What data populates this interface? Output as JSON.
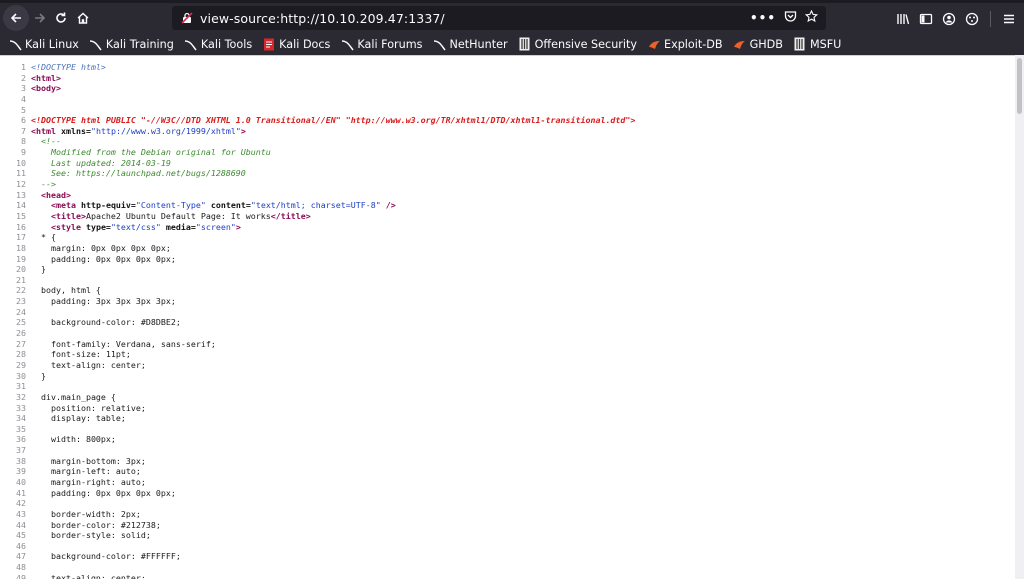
{
  "browser": {
    "url": "view-source:http://10.10.209.47:1337/"
  },
  "bookmarks": [
    {
      "label": "Kali Linux",
      "icon": "kali-dragon-icon"
    },
    {
      "label": "Kali Training",
      "icon": "kali-dragon-icon"
    },
    {
      "label": "Kali Tools",
      "icon": "kali-dragon-icon"
    },
    {
      "label": "Kali Docs",
      "icon": "kali-docs-icon"
    },
    {
      "label": "Kali Forums",
      "icon": "kali-dragon-icon"
    },
    {
      "label": "NetHunter",
      "icon": "kali-dragon-icon"
    },
    {
      "label": "Offensive Security",
      "icon": "offsec-icon"
    },
    {
      "label": "Exploit-DB",
      "icon": "exploitdb-icon"
    },
    {
      "label": "GHDB",
      "icon": "exploitdb-icon"
    },
    {
      "label": "MSFU",
      "icon": "offsec-icon"
    }
  ],
  "source_lines": [
    [
      [
        "doc",
        "<!DOCTYPE html>"
      ]
    ],
    [
      [
        "tag",
        "<html>"
      ]
    ],
    [
      [
        "tag",
        "<body>"
      ]
    ],
    [],
    [],
    [
      [
        "red",
        "<!DOCTYPE html PUBLIC \"-//W3C//DTD XHTML 1.0 Transitional//EN\" \"http://www.w3.org/TR/xhtml1/DTD/xhtml1-transitional.dtd\">"
      ]
    ],
    [
      [
        "tag",
        "<html "
      ],
      [
        "att",
        "xmlns="
      ],
      [
        "val",
        "\"http://www.w3.org/1999/xhtml\""
      ],
      [
        "tag",
        ">"
      ]
    ],
    [
      [
        "txt",
        "  "
      ],
      [
        "com",
        "<!--"
      ]
    ],
    [
      [
        "com",
        "    Modified from the Debian original for Ubuntu"
      ]
    ],
    [
      [
        "com",
        "    Last updated: 2014-03-19"
      ]
    ],
    [
      [
        "com",
        "    See: https://launchpad.net/bugs/1288690"
      ]
    ],
    [
      [
        "com",
        "  -->"
      ]
    ],
    [
      [
        "txt",
        "  "
      ],
      [
        "tag",
        "<head>"
      ]
    ],
    [
      [
        "txt",
        "    "
      ],
      [
        "tag",
        "<meta "
      ],
      [
        "att",
        "http-equiv="
      ],
      [
        "val",
        "\"Content-Type\""
      ],
      [
        "att",
        " content="
      ],
      [
        "val",
        "\"text/html; charset=UTF-8\""
      ],
      [
        "tag",
        " />"
      ]
    ],
    [
      [
        "txt",
        "    "
      ],
      [
        "tag",
        "<title>"
      ],
      [
        "txt",
        "Apache2 Ubuntu Default Page: It works"
      ],
      [
        "tag",
        "</title>"
      ]
    ],
    [
      [
        "txt",
        "    "
      ],
      [
        "tag",
        "<style "
      ],
      [
        "att",
        "type="
      ],
      [
        "val",
        "\"text/css\""
      ],
      [
        "att",
        " media="
      ],
      [
        "val",
        "\"screen\""
      ],
      [
        "tag",
        ">"
      ]
    ],
    [
      [
        "txt",
        "  * {"
      ]
    ],
    [
      [
        "txt",
        "    margin: 0px 0px 0px 0px;"
      ]
    ],
    [
      [
        "txt",
        "    padding: 0px 0px 0px 0px;"
      ]
    ],
    [
      [
        "txt",
        "  }"
      ]
    ],
    [],
    [
      [
        "txt",
        "  body, html {"
      ]
    ],
    [
      [
        "txt",
        "    padding: 3px 3px 3px 3px;"
      ]
    ],
    [],
    [
      [
        "txt",
        "    background-color: #D8DBE2;"
      ]
    ],
    [],
    [
      [
        "txt",
        "    font-family: Verdana, sans-serif;"
      ]
    ],
    [
      [
        "txt",
        "    font-size: 11pt;"
      ]
    ],
    [
      [
        "txt",
        "    text-align: center;"
      ]
    ],
    [
      [
        "txt",
        "  }"
      ]
    ],
    [],
    [
      [
        "txt",
        "  div.main_page {"
      ]
    ],
    [
      [
        "txt",
        "    position: relative;"
      ]
    ],
    [
      [
        "txt",
        "    display: table;"
      ]
    ],
    [],
    [
      [
        "txt",
        "    width: 800px;"
      ]
    ],
    [],
    [
      [
        "txt",
        "    margin-bottom: 3px;"
      ]
    ],
    [
      [
        "txt",
        "    margin-left: auto;"
      ]
    ],
    [
      [
        "txt",
        "    margin-right: auto;"
      ]
    ],
    [
      [
        "txt",
        "    padding: 0px 0px 0px 0px;"
      ]
    ],
    [],
    [
      [
        "txt",
        "    border-width: 2px;"
      ]
    ],
    [
      [
        "txt",
        "    border-color: #212738;"
      ]
    ],
    [
      [
        "txt",
        "    border-style: solid;"
      ]
    ],
    [],
    [
      [
        "txt",
        "    background-color: #FFFFFF;"
      ]
    ],
    [],
    [
      [
        "txt",
        "    text-align: center;"
      ]
    ]
  ]
}
